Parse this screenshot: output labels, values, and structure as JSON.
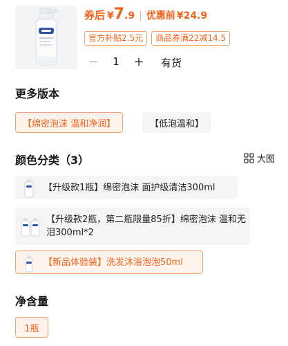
{
  "product": {
    "image_icon": "product-bottle-icon",
    "price": {
      "after_coupon_label": "券后",
      "currency": "¥",
      "after_coupon_int": "7",
      "after_coupon_dec": ".9",
      "separator": "|",
      "before_label": "优惠前",
      "before_value": "¥24.9"
    },
    "coupons": [
      "官方补贴2.5元",
      "商品券满22减14.5"
    ],
    "quantity": {
      "minus": "−",
      "value": "1",
      "plus": "+"
    },
    "stock_status": "有货"
  },
  "versions": {
    "title": "更多版本",
    "options": [
      {
        "label": "【绵密泡沫 温和净润】",
        "selected": true
      },
      {
        "label": "【低泡温和】",
        "selected": false
      }
    ]
  },
  "colors": {
    "title": "颜色分类（3）",
    "big_image_label": "大图",
    "big_image_icon": "grid-icon",
    "options": [
      {
        "line1": "【升级款1瓶】绵密泡沫 面护级清洁300ml",
        "line2": "",
        "selected": false,
        "icon": "single-bottle-icon"
      },
      {
        "line1": "【升级款2瓶，第二瓶限量85折】绵密泡沫 温和无",
        "line2": "泪300ml*2",
        "selected": false,
        "icon": "double-bottle-icon"
      },
      {
        "line1": "【新品体验装】洗发沐浴泡泡50ml",
        "line2": "",
        "selected": true,
        "icon": "small-bottle-icon"
      }
    ]
  },
  "volume": {
    "title": "净含量",
    "options": [
      {
        "label": "1瓶",
        "selected": true
      }
    ]
  },
  "colors_theme": {
    "accent": "#f0631a",
    "accent_border": "#f0a36d",
    "accent_bg": "#fff3ec",
    "chip_bg": "#f5f5f5"
  }
}
